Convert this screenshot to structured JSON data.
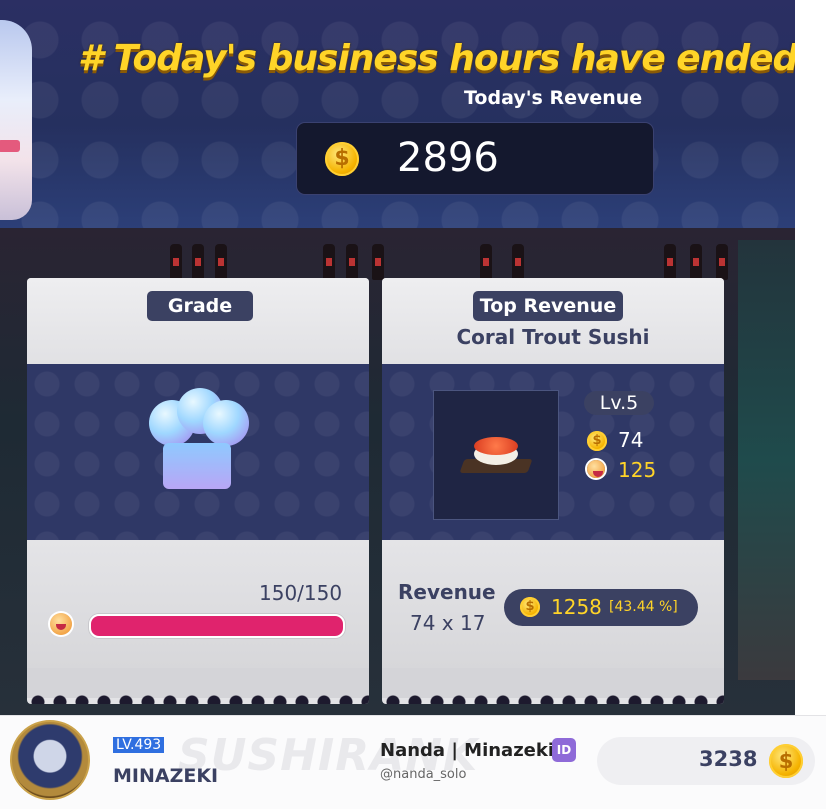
{
  "banner": {
    "headline": "# Today's business hours have ended!",
    "revenue_label": "Today's Revenue",
    "revenue_value": "2896",
    "coin_symbol": "$"
  },
  "grade_card": {
    "title": "Grade",
    "icon": "chef-hat-icon",
    "progress_text": "150/150",
    "progress_fraction": 1.0,
    "bar_color": "#e0236d"
  },
  "top_card": {
    "title": "Top Revenue",
    "dish_name": "Coral Trout Sushi",
    "level": "Lv.5",
    "price": "74",
    "taste": "125",
    "revenue_label": "Revenue",
    "revenue_calc": "74 x 17",
    "revenue_value": "1258",
    "revenue_pct": "[43.44 %]"
  },
  "footer": {
    "level": "LV.493",
    "username": "MINAZEKI",
    "watermark": "SUSHIRANK",
    "creator": "Nanda | Minazeki",
    "id_badge": "ID",
    "handle": "@nanda_solo",
    "gold": "3238",
    "coin_symbol": "$"
  },
  "colors": {
    "accent_gold": "#ffd428",
    "navy": "#3b4162",
    "pink": "#e0236d"
  }
}
